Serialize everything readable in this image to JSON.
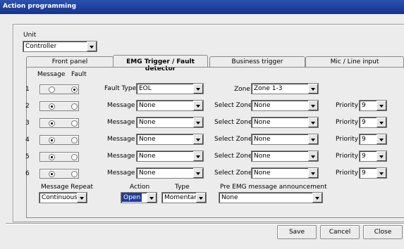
{
  "window": {
    "title": "Action programming"
  },
  "unit": {
    "label": "Unit",
    "value": "Controller"
  },
  "tabs": [
    {
      "label": "Front panel"
    },
    {
      "label": "EMG Trigger / Fault detector"
    },
    {
      "label": "Business trigger"
    },
    {
      "label": "Mic / Line input"
    }
  ],
  "columns": {
    "message": "Message",
    "fault": "Fault"
  },
  "row1": {
    "num": "1",
    "type_label": "Fault Type",
    "type_value": "EOL",
    "zone_label": "Zone",
    "zone_value": "Zone 1-3",
    "selected": "fault"
  },
  "rows": [
    {
      "num": "2",
      "msg_label": "Message",
      "msg_value": "None",
      "zone_label": "Select Zone",
      "zone_value": "None",
      "prio_label": "Priority",
      "prio_value": "9",
      "selected": "message"
    },
    {
      "num": "3",
      "msg_label": "Message",
      "msg_value": "None",
      "zone_label": "Select Zone",
      "zone_value": "None",
      "prio_label": "Priority",
      "prio_value": "9",
      "selected": "message"
    },
    {
      "num": "4",
      "msg_label": "Message",
      "msg_value": "None",
      "zone_label": "Select Zone",
      "zone_value": "None",
      "prio_label": "Priority",
      "prio_value": "9",
      "selected": "message"
    },
    {
      "num": "5",
      "msg_label": "Message",
      "msg_value": "None",
      "zone_label": "Select Zone",
      "zone_value": "None",
      "prio_label": "Priority",
      "prio_value": "9",
      "selected": "message"
    },
    {
      "num": "6",
      "msg_label": "Message",
      "msg_value": "None",
      "zone_label": "Select Zone",
      "zone_value": "None",
      "prio_label": "Priority",
      "prio_value": "9",
      "selected": "message"
    }
  ],
  "bottom": {
    "repeat_label": "Message Repeat",
    "repeat_value": "Continuous",
    "action_label": "Action",
    "action_value": "Open",
    "type_label": "Type",
    "type_value": "Momentary",
    "pre_label": "Pre EMG message announcement",
    "pre_value": "None"
  },
  "buttons": {
    "save": "Save",
    "cancel": "Cancel",
    "close": "Close"
  }
}
